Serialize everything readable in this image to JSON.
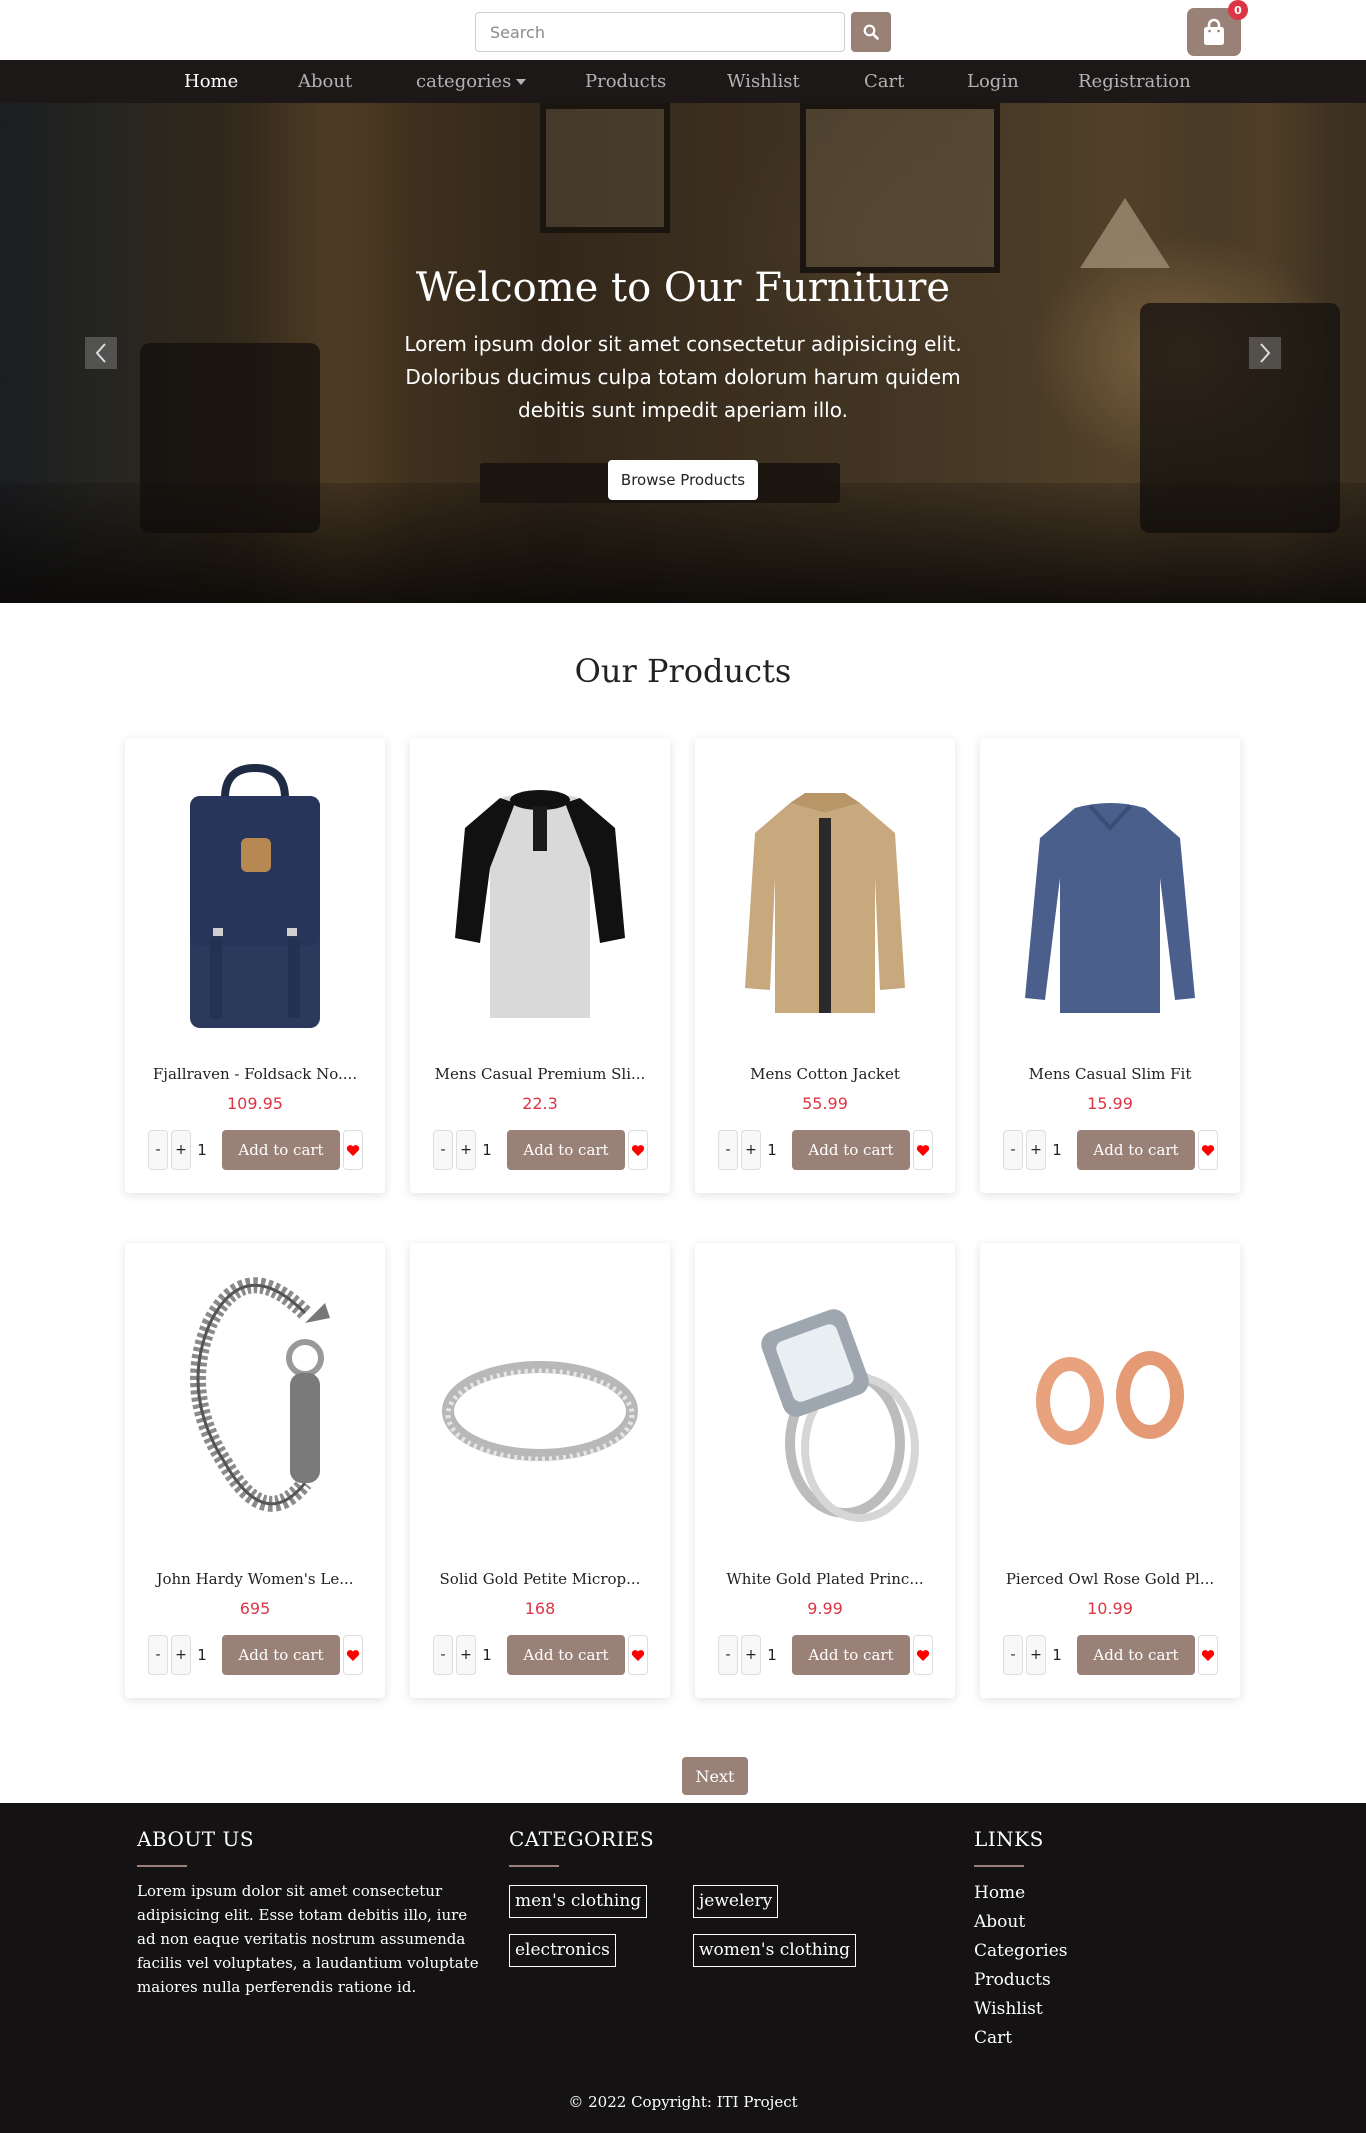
{
  "search": {
    "placeholder": "Search"
  },
  "cart_badge": {
    "count": "0"
  },
  "nav": {
    "items": [
      "Home",
      "About",
      "categories",
      "Products",
      "Wishlist",
      "Cart",
      "Login",
      "Registration"
    ],
    "active": "Home"
  },
  "hero": {
    "title": "Welcome to Our Furniture",
    "text": "Lorem ipsum dolor sit amet consectetur adipisicing elit. Doloribus ducimus culpa totam dolorum harum quidem debitis sunt impedit aperiam illo.",
    "button": "Browse Products"
  },
  "products_section": {
    "title": "Our Products",
    "items": [
      {
        "name": "Fjallraven - Foldsack No....",
        "price": "109.95",
        "qty": "1",
        "image": "backpack"
      },
      {
        "name": "Mens Casual Premium Sli...",
        "price": "22.3",
        "qty": "1",
        "image": "raglan-shirt"
      },
      {
        "name": "Mens Cotton Jacket",
        "price": "55.99",
        "qty": "1",
        "image": "jacket"
      },
      {
        "name": "Mens Casual Slim Fit",
        "price": "15.99",
        "qty": "1",
        "image": "longsleeve"
      },
      {
        "name": "John Hardy Women's Le...",
        "price": "695",
        "qty": "1",
        "image": "bracelet"
      },
      {
        "name": "Solid Gold Petite Microp...",
        "price": "168",
        "qty": "1",
        "image": "ring"
      },
      {
        "name": "White Gold Plated Princ...",
        "price": "9.99",
        "qty": "1",
        "image": "diamond-ring"
      },
      {
        "name": "Pierced Owl Rose Gold Pl...",
        "price": "10.99",
        "qty": "1",
        "image": "earrings"
      }
    ],
    "minus_label": "-",
    "plus_label": "+",
    "add_label": "Add to cart",
    "next_label": "Next"
  },
  "footer": {
    "about_heading": "ABOUT US",
    "about_text": "Lorem ipsum dolor sit amet consectetur adipisicing elit. Esse totam debitis illo, iure ad non eaque veritatis nostrum assumenda facilis vel voluptates, a laudantium voluptate maiores nulla perferendis ratione id.",
    "categories_heading": "CATEGORIES",
    "categories": [
      "men's clothing",
      "jewelery",
      "electronics",
      "women's clothing"
    ],
    "links_heading": "LINKS",
    "links": [
      "Home",
      "About",
      "Categories",
      "Products",
      "Wishlist",
      "Cart"
    ],
    "copyright": "© 2022 Copyright: ITI Project"
  },
  "colors": {
    "accent": "#9a8177",
    "price": "#dc3545",
    "nav_bg": "#1c1817",
    "footer_bg": "#141212"
  }
}
